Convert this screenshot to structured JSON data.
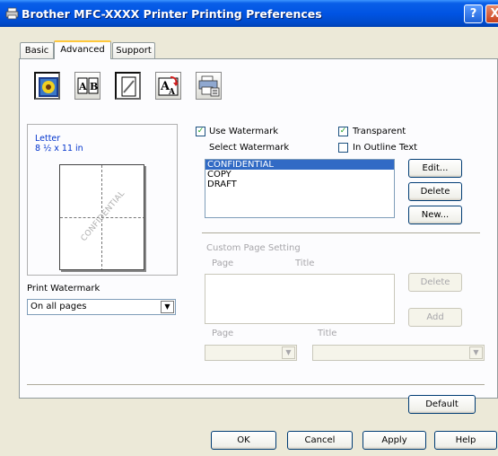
{
  "window": {
    "title": "Brother MFC-XXXX Printer Printing Preferences",
    "help_glyph": "?",
    "close_glyph": "X"
  },
  "tabs": [
    {
      "label": "Basic"
    },
    {
      "label": "Advanced"
    },
    {
      "label": "Support"
    }
  ],
  "toolbar_icons": [
    "color-icon",
    "duplex-icon",
    "watermark-icon",
    "scaling-icon",
    "device-options-icon"
  ],
  "preview": {
    "paper_name": "Letter",
    "paper_size": "8 ½ x 11 in",
    "watermark_text": "CONFIDENTIAL"
  },
  "print_watermark": {
    "label": "Print Watermark",
    "value": "On all pages"
  },
  "watermark": {
    "use_watermark_label": "Use Watermark",
    "use_watermark_checked": true,
    "transparent_label": "Transparent",
    "transparent_checked": true,
    "outline_label": "In Outline Text",
    "outline_checked": false,
    "select_label": "Select Watermark",
    "items": [
      "CONFIDENTIAL",
      "COPY",
      "DRAFT"
    ],
    "selected_index": 0,
    "edit_label": "Edit...",
    "delete_label": "Delete",
    "new_label": "New..."
  },
  "custom_page": {
    "heading": "Custom Page Setting",
    "page_col": "Page",
    "title_col": "Title",
    "delete_label": "Delete",
    "add_label": "Add",
    "page_label": "Page",
    "title_label": "Title"
  },
  "default_label": "Default",
  "footer": {
    "ok": "OK",
    "cancel": "Cancel",
    "apply": "Apply",
    "help": "Help"
  }
}
